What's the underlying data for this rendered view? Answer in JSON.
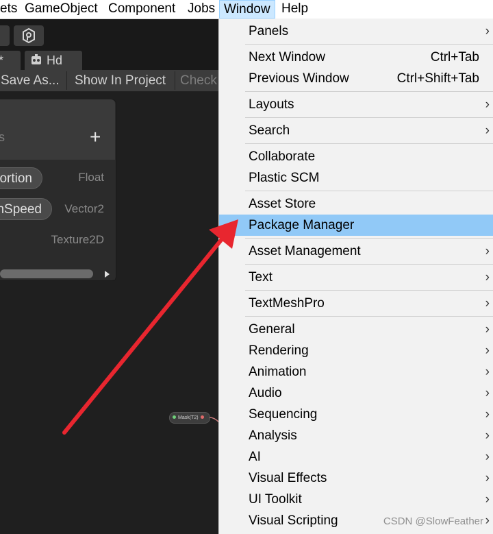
{
  "menubar": {
    "items": [
      {
        "label": "ets"
      },
      {
        "label": "GameObject"
      },
      {
        "label": "Component"
      },
      {
        "label": "Jobs"
      },
      {
        "label": "Window"
      },
      {
        "label": "Help"
      }
    ]
  },
  "editor": {
    "tab_star": "*",
    "tab_label": "Hd",
    "subtoolbar": {
      "save_as": "Save As...",
      "show_in_project": "Show In Project",
      "check": "Check"
    },
    "blackboard": {
      "header_partial": "s",
      "add_symbol": "+",
      "properties": [
        {
          "name": "ortion",
          "type": "Float"
        },
        {
          "name": "nSpeed",
          "type": "Vector2"
        },
        {
          "name": "",
          "type": "Texture2D"
        }
      ]
    },
    "node_label": "Mask(T2)"
  },
  "window_menu": {
    "items": [
      {
        "label": "Panels",
        "shortcut": "",
        "submenu": true
      },
      {
        "label": "Next Window",
        "shortcut": "Ctrl+Tab",
        "submenu": false
      },
      {
        "label": "Previous Window",
        "shortcut": "Ctrl+Shift+Tab",
        "submenu": false
      },
      {
        "label": "Layouts",
        "shortcut": "",
        "submenu": true
      },
      {
        "label": "Search",
        "shortcut": "",
        "submenu": true
      },
      {
        "label": "Collaborate",
        "shortcut": "",
        "submenu": false
      },
      {
        "label": "Plastic SCM",
        "shortcut": "",
        "submenu": false
      },
      {
        "label": "Asset Store",
        "shortcut": "",
        "submenu": false
      },
      {
        "label": "Package Manager",
        "shortcut": "",
        "submenu": false,
        "highlighted": true
      },
      {
        "label": "Asset Management",
        "shortcut": "",
        "submenu": true
      },
      {
        "label": "Text",
        "shortcut": "",
        "submenu": true
      },
      {
        "label": "TextMeshPro",
        "shortcut": "",
        "submenu": true
      },
      {
        "label": "General",
        "shortcut": "",
        "submenu": true
      },
      {
        "label": "Rendering",
        "shortcut": "",
        "submenu": true
      },
      {
        "label": "Animation",
        "shortcut": "",
        "submenu": true
      },
      {
        "label": "Audio",
        "shortcut": "",
        "submenu": true
      },
      {
        "label": "Sequencing",
        "shortcut": "",
        "submenu": true
      },
      {
        "label": "Analysis",
        "shortcut": "",
        "submenu": true
      },
      {
        "label": "AI",
        "shortcut": "",
        "submenu": true
      },
      {
        "label": "Visual Effects",
        "shortcut": "",
        "submenu": true
      },
      {
        "label": "UI Toolkit",
        "shortcut": "",
        "submenu": true
      },
      {
        "label": "Visual Scripting",
        "shortcut": "",
        "submenu": true
      }
    ],
    "chevron": "›"
  },
  "watermark": "CSDN @SlowFeather",
  "colors": {
    "highlight": "#91c9f7",
    "arrow": "#e8262f",
    "menu_bg": "#f2f2f2",
    "editor_bg": "#1f1f1f"
  }
}
